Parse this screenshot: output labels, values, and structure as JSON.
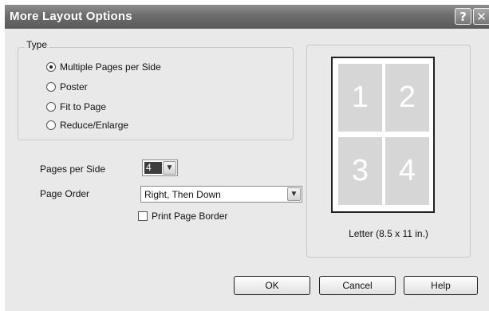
{
  "window": {
    "title": "More Layout Options",
    "help_glyph": "?",
    "close_glyph": "✕"
  },
  "type_group": {
    "label": "Type",
    "options": [
      {
        "label": "Multiple Pages per Side",
        "checked": true
      },
      {
        "label": "Poster",
        "checked": false
      },
      {
        "label": "Fit to Page",
        "checked": false
      },
      {
        "label": "Reduce/Enlarge",
        "checked": false
      }
    ]
  },
  "pages_per_side": {
    "label": "Pages per Side",
    "value": "4"
  },
  "page_order": {
    "label": "Page Order",
    "value": "Right, Then Down"
  },
  "print_page_border": {
    "label": "Print Page Border",
    "checked": false
  },
  "preview": {
    "cells": [
      "1",
      "2",
      "3",
      "4"
    ],
    "paper_label": "Letter (8.5 x 11 in.)"
  },
  "buttons": {
    "ok": "OK",
    "cancel": "Cancel",
    "help": "Help"
  },
  "icons": {
    "dropdown": "chevron-down-icon"
  }
}
